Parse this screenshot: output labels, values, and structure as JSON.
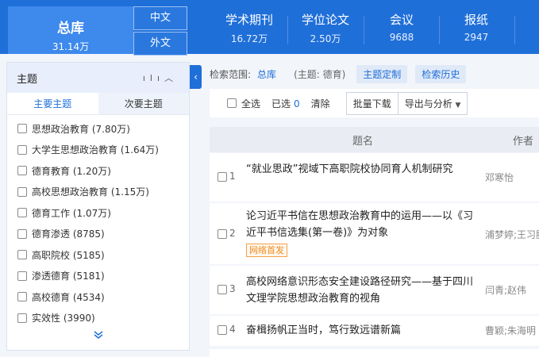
{
  "nav": {
    "main": {
      "label": "总库",
      "count": "31.14万"
    },
    "lang_zh": "中文",
    "lang_en": "外文",
    "items": [
      {
        "label": "学术期刊",
        "count": "16.72万"
      },
      {
        "label": "学位论文",
        "count": "2.50万"
      },
      {
        "label": "会议",
        "count": "9688"
      },
      {
        "label": "报纸",
        "count": "2947"
      }
    ]
  },
  "sidebar": {
    "title": "主题",
    "tab_main": "主要主题",
    "tab_secondary": "次要主题",
    "items": [
      {
        "label": "思想政治教育 (7.80万)"
      },
      {
        "label": "大学生思想政治教育 (1.64万)"
      },
      {
        "label": "德育教育 (1.20万)"
      },
      {
        "label": "高校思想政治教育 (1.15万)"
      },
      {
        "label": "德育工作 (1.07万)"
      },
      {
        "label": "德育渗透 (8785)"
      },
      {
        "label": "高职院校 (5185)"
      },
      {
        "label": "渗透德育 (5181)"
      },
      {
        "label": "高校德育 (4534)"
      },
      {
        "label": "实效性 (3990)"
      }
    ]
  },
  "scope": {
    "label": "检索范围:",
    "value": "总库",
    "query": "(主题: 德育)",
    "btn_custom": "主题定制",
    "btn_history": "检索历史"
  },
  "toolbar": {
    "select_all": "全选",
    "selected_label": "已选",
    "selected_count": "0",
    "clear": "清除",
    "batch_download": "批量下载",
    "export": "导出与分析"
  },
  "table": {
    "col_title": "题名",
    "col_author": "作者",
    "rows": [
      {
        "num": "1",
        "title": "“就业思政”视域下高职院校协同育人机制研究",
        "author": "邓寒怡",
        "tag": ""
      },
      {
        "num": "2",
        "title": "论习近平书信在思想政治教育中的运用——以《习近平书信选集(第一卷)》为对象",
        "author": "浦梦婷;王习胜",
        "tag": "网络首发"
      },
      {
        "num": "3",
        "title": "高校网络意识形态安全建设路径研究——基于四川文理学院思想政治教育的视角",
        "author": "闫青;赵伟",
        "tag": ""
      },
      {
        "num": "4",
        "title": "奋楫扬帆正当时，笃行致远谱新篇",
        "author": "曹颖;朱海明",
        "tag": ""
      }
    ]
  }
}
